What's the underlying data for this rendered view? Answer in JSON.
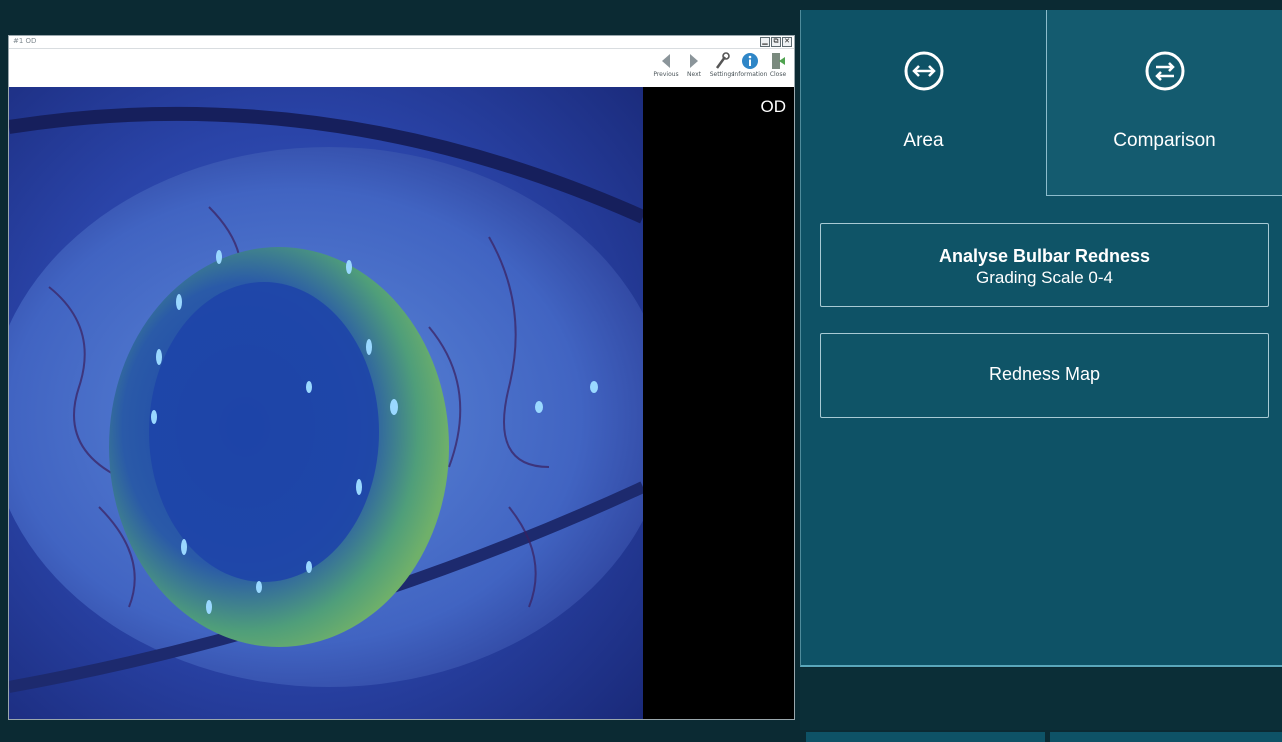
{
  "viewer": {
    "window_title": "#1 OD",
    "window_controls": [
      "▁",
      "⧉",
      "✕"
    ],
    "toolbar": [
      {
        "label": "Previous",
        "icon": "arrow-left-icon"
      },
      {
        "label": "Next",
        "icon": "arrow-right-icon"
      },
      {
        "label": "Settings",
        "icon": "settings-icon"
      },
      {
        "label": "Information",
        "icon": "information-icon"
      },
      {
        "label": "Close",
        "icon": "close-door-icon"
      }
    ],
    "eye_label": "OD"
  },
  "panel": {
    "tabs": [
      {
        "label": "Area",
        "icon": "horizontal-arrows-icon"
      },
      {
        "label": "Comparison",
        "icon": "swap-arrows-icon"
      }
    ],
    "analyse_button": {
      "title": "Analyse Bulbar Redness",
      "subtitle": "Grading Scale 0-4"
    },
    "redness_map_button": {
      "label": "Redness Map"
    }
  },
  "colors": {
    "panel_bg": "#0e5266",
    "page_bg": "#0b2a33",
    "button_border": "#a8cad4"
  }
}
